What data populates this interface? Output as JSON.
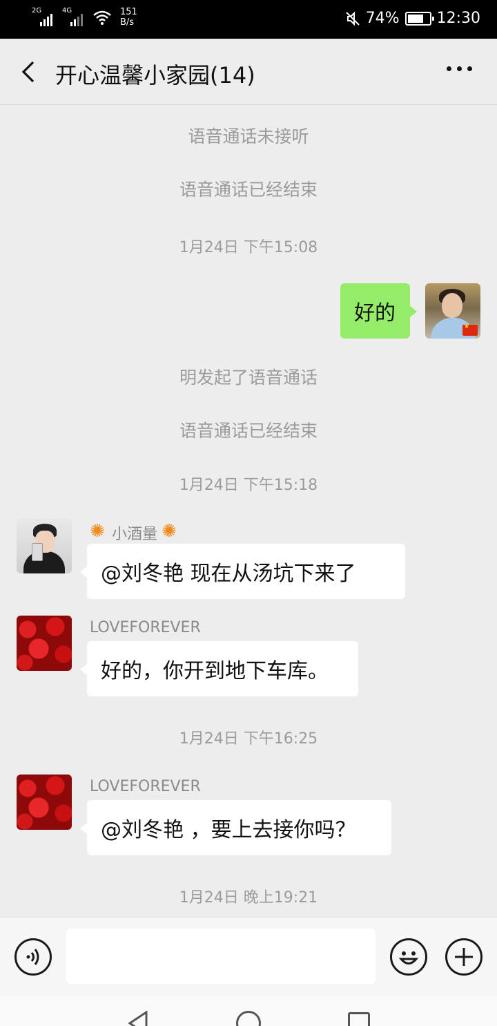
{
  "status_bar": {
    "signal1_tag": "2G",
    "signal2_tag": "4G",
    "speed_value": "151",
    "speed_unit": "B/s",
    "battery_percent": "74%",
    "battery_level": 0.74,
    "time": "12:30",
    "icons": [
      "signal-icon",
      "wifi-icon",
      "mute-icon",
      "battery-icon"
    ]
  },
  "header": {
    "title": "开心温馨小家园(14)",
    "back_icon": "back-arrow-icon",
    "more_icon": "more-dots-icon"
  },
  "messages": {
    "sys_1": "语音通话未接听",
    "sys_2": "语音通话已经结束",
    "ts_1": "1月24日 下午15:08",
    "self_msg_1": "好的",
    "sys_3": "明发起了语音通话",
    "sys_4": "语音通话已经结束",
    "ts_2": "1月24日 下午15:18",
    "sender_1": "小酒量",
    "msg_1": "@刘冬艳  现在从汤坑下来了",
    "sender_2": "LOVEFOREVER",
    "msg_2": "好的，你开到地下车库。",
    "ts_3": "1月24日 下午16:25",
    "sender_3": "LOVEFOREVER",
    "msg_3": "@刘冬艳 ，要上去接你吗？",
    "ts_4": "1月24日 晚上19:21"
  },
  "input_bar": {
    "value": "",
    "icons": [
      "voice-icon",
      "emoji-icon",
      "plus-icon"
    ]
  },
  "nav_bar": {
    "icons": [
      "nav-back-icon",
      "nav-home-icon",
      "nav-recent-icon"
    ]
  },
  "colors": {
    "background": "#ededed",
    "self_bubble": "#95ec69",
    "other_bubble": "#ffffff",
    "system_text": "#9b9b9b"
  }
}
